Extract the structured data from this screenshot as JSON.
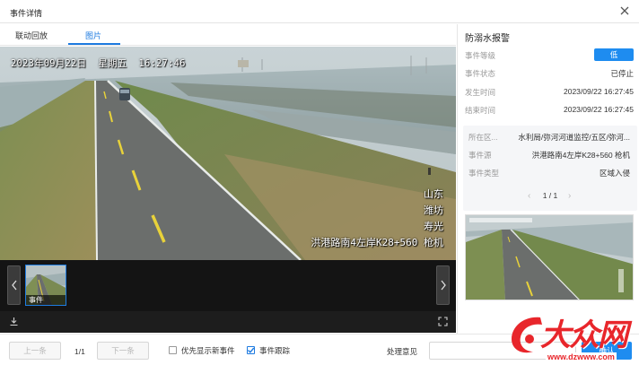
{
  "window": {
    "title": "事件详情",
    "close_icon": "close-icon"
  },
  "tabs": [
    {
      "label": "联动回放",
      "active": false
    },
    {
      "label": "图片",
      "active": true
    }
  ],
  "video": {
    "osd_timestamp": "2023年09月22日  星期五  16:27:46",
    "osd_location": [
      "山东",
      "潍坊",
      "寿光",
      "洪港路南4左岸K28+560 枪机"
    ]
  },
  "thumbnails": [
    {
      "label": "事件",
      "selected": true
    }
  ],
  "video_toolbar": {
    "download_icon": "download-icon",
    "fullscreen_icon": "fullscreen-icon"
  },
  "panel": {
    "title": "防溺水报警",
    "fields": [
      {
        "key": "事件等级",
        "value": "低",
        "badge": true
      },
      {
        "key": "事件状态",
        "value": "已停止"
      },
      {
        "key": "发生时间",
        "value": "2023/09/22 16:27:45"
      },
      {
        "key": "结束时间",
        "value": "2023/09/22 16:27:45"
      }
    ],
    "details": [
      {
        "key": "所在区...",
        "value": "水利局/弥河河道监控/五区/弥河..."
      },
      {
        "key": "事件源",
        "value": "洪港路南4左岸K28+560 枪机"
      },
      {
        "key": "事件类型",
        "value": "区域入侵"
      }
    ],
    "pager": "1 / 1"
  },
  "bottom": {
    "prev": "上一条",
    "count": "1/1",
    "next": "下一条",
    "checkbox_priority": {
      "label": "优先显示新事件",
      "checked": false
    },
    "checkbox_follow": {
      "label": "事件跟踪",
      "checked": true
    },
    "opinion_label": "处理意见",
    "opinion_value": "",
    "confirm": "确认"
  },
  "watermark": {
    "text": "大众网",
    "url": "www.dzwww.com"
  },
  "colors": {
    "accent": "#1e7be0",
    "badge": "#1e8cf0",
    "watermark": "#e8262b"
  }
}
